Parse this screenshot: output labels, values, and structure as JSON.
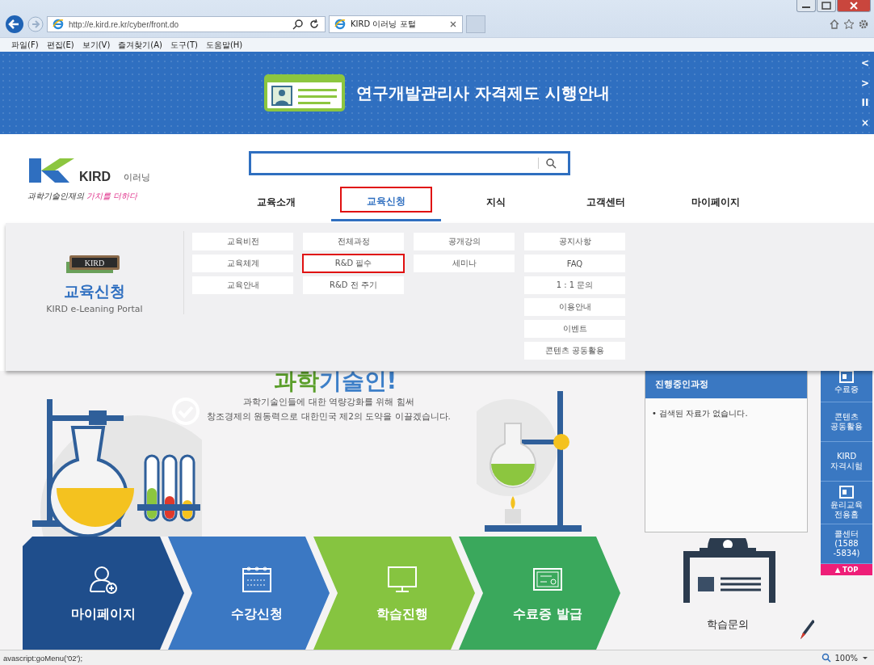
{
  "browser": {
    "url": "http://e.kird.re.kr/cyber/front.do",
    "tab_title": "KIRD 이러닝 포털",
    "menu": [
      "파일(F)",
      "편집(E)",
      "보기(V)",
      "즐겨찾기(A)",
      "도구(T)",
      "도움말(H)"
    ],
    "status_text": "avascript:goMenu('02');",
    "zoom": "100%"
  },
  "banner": {
    "title": "연구개발관리사 자격제도 시행안내",
    "controls": [
      "<",
      ">",
      "II",
      "×"
    ]
  },
  "header": {
    "logo_text": "KIRD",
    "logo_sub": "이러닝",
    "slogan_main": "과학기술인재의",
    "slogan_accent": "가치를 더하다",
    "nav": [
      {
        "label": "교육소개",
        "selected": false,
        "marked": false
      },
      {
        "label": "교육신청",
        "selected": true,
        "marked": true
      },
      {
        "label": "지식",
        "selected": false,
        "marked": false
      },
      {
        "label": "고객센터",
        "selected": false,
        "marked": false
      },
      {
        "label": "마이페이지",
        "selected": false,
        "marked": false
      }
    ]
  },
  "dropdown": {
    "badge_text": "KIRD",
    "title": "교육신청",
    "subtitle": "KIRD e-Leaning Portal",
    "columns": [
      [
        {
          "label": "교육비전",
          "marked": false
        },
        {
          "label": "교육체계",
          "marked": false
        },
        {
          "label": "교육안내",
          "marked": false
        }
      ],
      [
        {
          "label": "전체과정",
          "marked": false
        },
        {
          "label": "R&D 필수",
          "marked": true
        },
        {
          "label": "R&D 전 주기",
          "marked": false
        }
      ],
      [
        {
          "label": "공개강의",
          "marked": false
        },
        {
          "label": "세미나",
          "marked": false
        }
      ],
      [
        {
          "label": "공지사항",
          "marked": false
        },
        {
          "label": "FAQ",
          "marked": false
        },
        {
          "label": "1 : 1 문의",
          "marked": false
        },
        {
          "label": "이용안내",
          "marked": false
        },
        {
          "label": "이벤트",
          "marked": false
        },
        {
          "label": "콘텐츠 공동활용",
          "marked": false
        }
      ]
    ]
  },
  "hero": {
    "heading": [
      {
        "text": "과학",
        "color": "#5a9e2a"
      },
      {
        "text": "기술인!",
        "color": "#3d7fc8"
      }
    ],
    "lines": [
      "과학기술인들에 대한 역량강화를 위해 힘써",
      "창조경제의 원동력으로 대한민국 제2의 도약을 이끌겠습니다."
    ]
  },
  "panel": {
    "title": "진행중인과정",
    "empty": "• 검색된 자료가 없습니다."
  },
  "quick_menu": {
    "items": [
      {
        "kind": "icon-label",
        "label": "수료증"
      },
      {
        "kind": "label",
        "label": "콘텐츠\n공동활용"
      },
      {
        "kind": "label",
        "label": "KIRD\n자격시험"
      },
      {
        "kind": "icon-label",
        "label": "윤리교육\n전용홈"
      },
      {
        "kind": "label",
        "label": "콜센터\n(1588\n-5834)"
      }
    ],
    "top": "▲ TOP"
  },
  "steps": [
    {
      "kind": "person",
      "label": "마이페이지",
      "color": "#1f4e8c"
    },
    {
      "kind": "calendar",
      "label": "수강신청",
      "color": "#3b78c3"
    },
    {
      "kind": "monitor",
      "label": "학습진행",
      "color": "#86c440"
    },
    {
      "kind": "certificate",
      "label": "수료증 발급",
      "color": "#3aa85c"
    }
  ],
  "help": {
    "label": "학습문의"
  }
}
